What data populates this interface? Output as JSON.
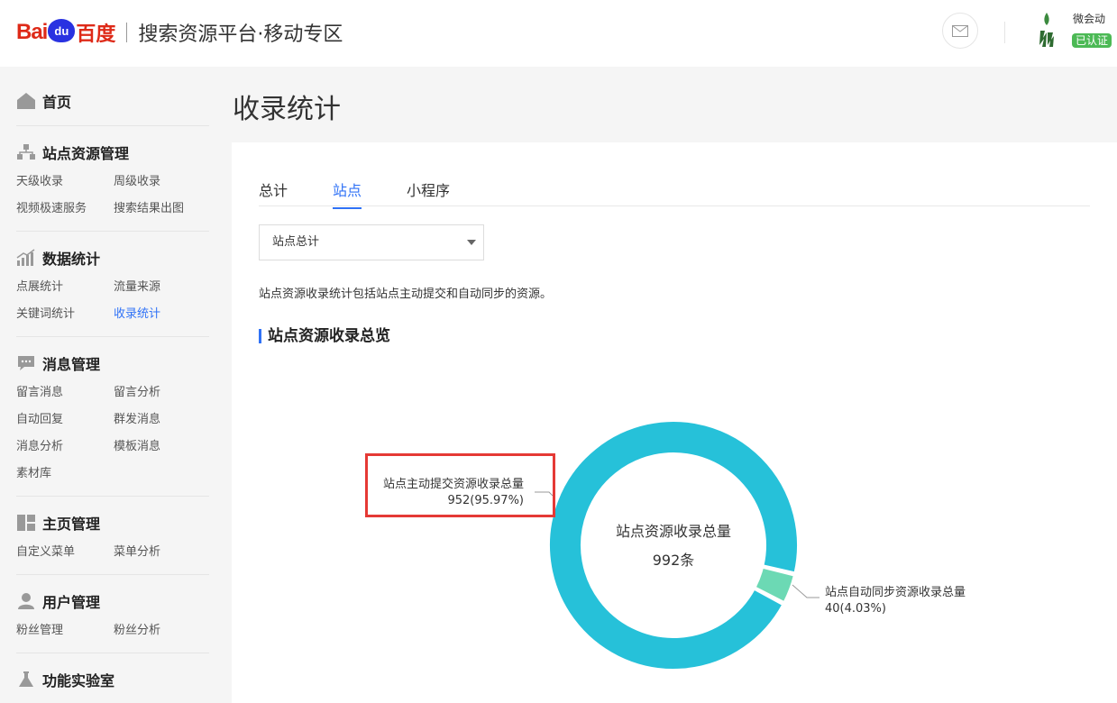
{
  "header": {
    "logo_bai": "Bai",
    "logo_du": "du",
    "logo_baidu_cn": "百度",
    "platform_title": "搜索资源平台·移动专区",
    "user_name": "微会动",
    "user_badge": "已认证"
  },
  "sidebar": {
    "home": "首页",
    "groups": [
      {
        "title": "站点资源管理",
        "icon": "sitemap-icon",
        "items": [
          "天级收录",
          "周级收录",
          "视频极速服务",
          "搜索结果出图"
        ]
      },
      {
        "title": "数据统计",
        "icon": "bar-chart-icon",
        "items": [
          "点展统计",
          "流量来源",
          "关键词统计",
          "收录统计"
        ]
      },
      {
        "title": "消息管理",
        "icon": "chat-bubble-icon",
        "items": [
          "留言消息",
          "留言分析",
          "自动回复",
          "群发消息",
          "消息分析",
          "模板消息",
          "素材库"
        ]
      },
      {
        "title": "主页管理",
        "icon": "layout-icon",
        "items": [
          "自定义菜单",
          "菜单分析"
        ]
      },
      {
        "title": "用户管理",
        "icon": "user-icon",
        "items": [
          "粉丝管理",
          "粉丝分析"
        ]
      },
      {
        "title": "功能实验室",
        "icon": "flask-icon",
        "items": []
      }
    ],
    "active_item": "收录统计"
  },
  "main": {
    "page_title": "收录统计",
    "tabs": [
      "总计",
      "站点",
      "小程序"
    ],
    "active_tab": "站点",
    "select_value": "站点总计",
    "description": "站点资源收录统计包括站点主动提交和自动同步的资源。",
    "section_title": "站点资源收录总览"
  },
  "chart_data": {
    "type": "pie",
    "center_title": "站点资源收录总量",
    "center_value": "992条",
    "total": 992,
    "slices": [
      {
        "name": "站点主动提交资源收录总量",
        "value": 952,
        "label": "952(95.97%)",
        "color": "#26c1d9"
      },
      {
        "name": "站点自动同步资源收录总量",
        "value": 40,
        "label": "40(4.03%)",
        "color": "#6cd9b4"
      }
    ]
  },
  "colors": {
    "accent": "#3072f6",
    "highlight_box": "#e53935",
    "badge": "#4cb955"
  }
}
